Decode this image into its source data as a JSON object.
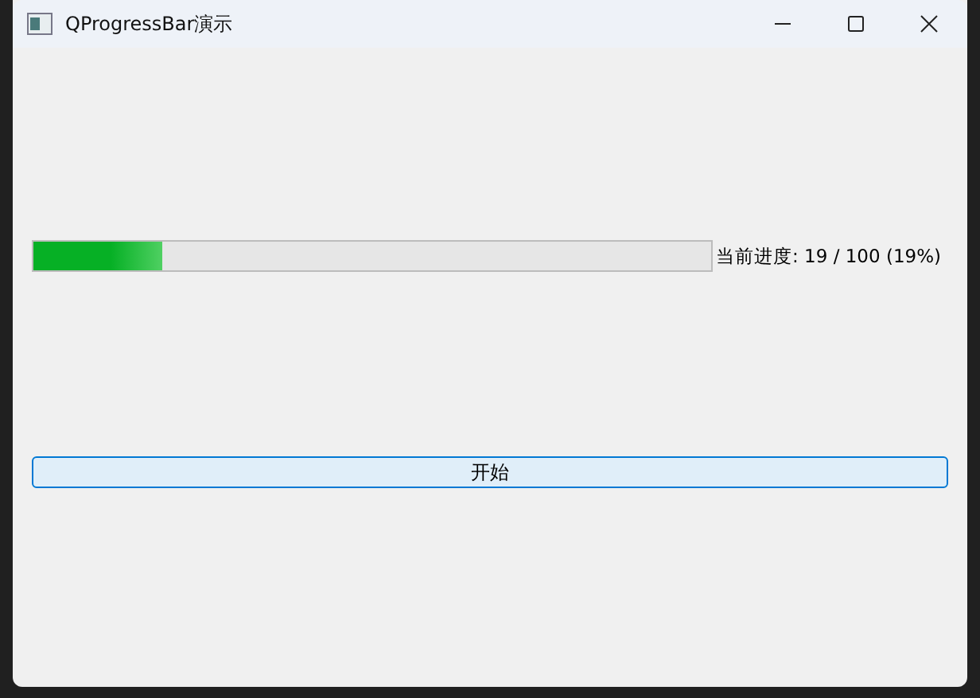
{
  "window": {
    "title": "QProgressBar演示"
  },
  "progress": {
    "level": 0.19,
    "reading": "当前进度: 19 / 100 (19%)"
  },
  "button": {
    "label": "开始"
  }
}
